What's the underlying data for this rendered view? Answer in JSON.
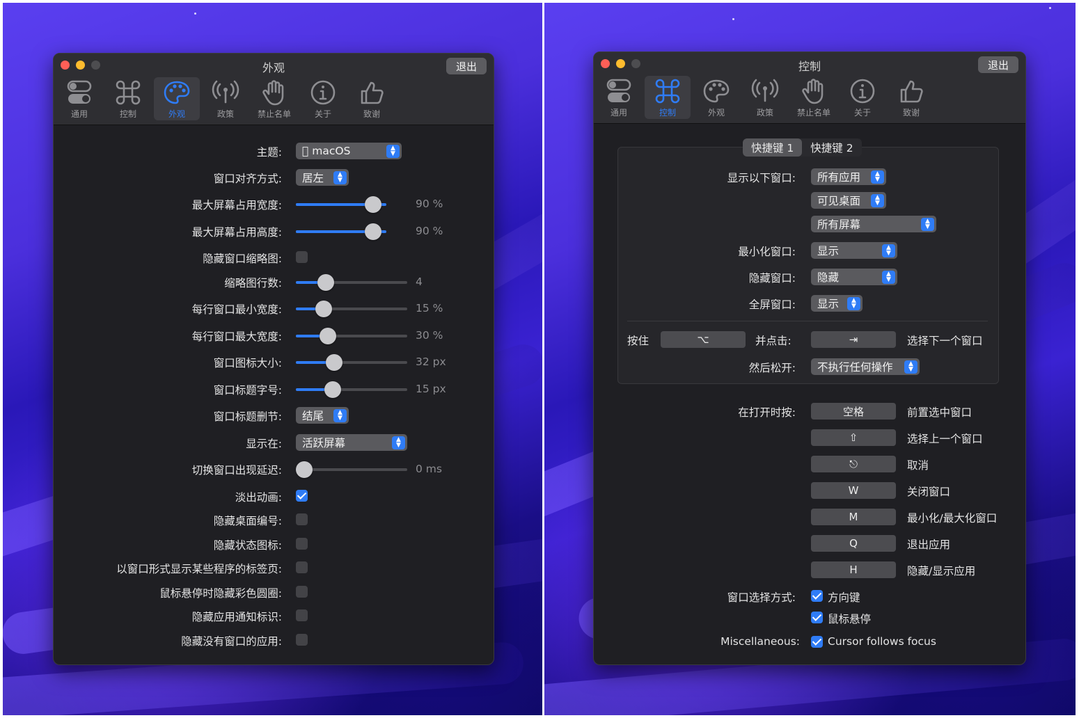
{
  "colors": {
    "accent": "#2f7cf6",
    "window_bg": "#1f1f23",
    "wallpaper": "#3a22d2"
  },
  "tabs": [
    {
      "label": "通用",
      "icon": "toggles-icon"
    },
    {
      "label": "控制",
      "icon": "command-icon"
    },
    {
      "label": "外观",
      "icon": "palette-icon"
    },
    {
      "label": "政策",
      "icon": "antenna-icon"
    },
    {
      "label": "禁止名单",
      "icon": "hand-icon"
    },
    {
      "label": "关于",
      "icon": "info-icon"
    },
    {
      "label": "致谢",
      "icon": "thumbs-up-icon"
    }
  ],
  "left": {
    "title": "外观",
    "quit_label": "退出",
    "active_tab": "外观",
    "theme": {
      "label": "主题:",
      "value": "macOS"
    },
    "align": {
      "label": "窗口对齐方式:",
      "value": "居左"
    },
    "sliders": [
      {
        "label": "最大屏幕占用宽度:",
        "value_text": "90 %",
        "fraction": 0.84
      },
      {
        "label": "最大屏幕占用高度:",
        "value_text": "90 %",
        "fraction": 0.84
      },
      {
        "label": "缩略图行数:",
        "value_text": "4",
        "fraction": 0.21
      },
      {
        "label": "每行窗口最小宽度:",
        "value_text": "15 %",
        "fraction": 0.19
      },
      {
        "label": "每行窗口最大宽度:",
        "value_text": "30 %",
        "fraction": 0.23
      },
      {
        "label": "窗口图标大小:",
        "value_text": "32 px",
        "fraction": 0.29
      },
      {
        "label": "窗口标题字号:",
        "value_text": "15 px",
        "fraction": 0.28
      }
    ],
    "hide_thumbnails": {
      "label": "隐藏窗口缩略图:",
      "checked": false
    },
    "title_truncation": {
      "label": "窗口标题删节:",
      "value": "结尾"
    },
    "show_on": {
      "label": "显示在:",
      "value": "活跃屏幕"
    },
    "delay": {
      "label": "切换窗口出现延迟:",
      "value_text": "0 ms",
      "fraction": 0.0
    },
    "checkboxes": [
      {
        "label": "淡出动画:",
        "checked": true
      },
      {
        "label": "隐藏桌面编号:",
        "checked": false
      },
      {
        "label": "隐藏状态图标:",
        "checked": false
      },
      {
        "label": "以窗口形式显示某些程序的标签页:",
        "checked": false
      },
      {
        "label": "鼠标悬停时隐藏彩色圆圈:",
        "checked": false
      },
      {
        "label": "隐藏应用通知标识:",
        "checked": false
      },
      {
        "label": "隐藏没有窗口的应用:",
        "checked": false
      }
    ]
  },
  "right": {
    "title": "控制",
    "quit_label": "退出",
    "active_tab": "控制",
    "segments": [
      "快捷键 1",
      "快捷键 2"
    ],
    "show_windows": {
      "label": "显示以下窗口:",
      "values": [
        "所有应用",
        "可见桌面",
        "所有屏幕"
      ]
    },
    "minimized": {
      "label": "最小化窗口:",
      "value": "显示"
    },
    "hidden": {
      "label": "隐藏窗口:",
      "value": "隐藏"
    },
    "fullscreen": {
      "label": "全屏窗口:",
      "value": "显示"
    },
    "hold": {
      "label": "按住",
      "key": "⌥",
      "then_label": "并点击:",
      "then_key": "⇥",
      "action": "选择下一个窗口"
    },
    "release": {
      "label": "然后松开:",
      "value": "不执行任何操作"
    },
    "open_label": "在打开时按:",
    "open_keys": [
      {
        "key": "空格",
        "action": "前置选中窗口"
      },
      {
        "key": "⇧",
        "action": "选择上一个窗口"
      },
      {
        "key": "⎋",
        "action": "取消"
      },
      {
        "key": "W",
        "action": "关闭窗口"
      },
      {
        "key": "M",
        "action": "最小化/最大化窗口"
      },
      {
        "key": "Q",
        "action": "退出应用"
      },
      {
        "key": "H",
        "action": "隐藏/显示应用"
      }
    ],
    "selection": {
      "label": "窗口选择方式:",
      "options": [
        {
          "label": "方向键",
          "checked": true
        },
        {
          "label": "鼠标悬停",
          "checked": true
        }
      ]
    },
    "misc": {
      "label": "Miscellaneous:",
      "option": {
        "label": "Cursor follows focus",
        "checked": true
      }
    }
  }
}
